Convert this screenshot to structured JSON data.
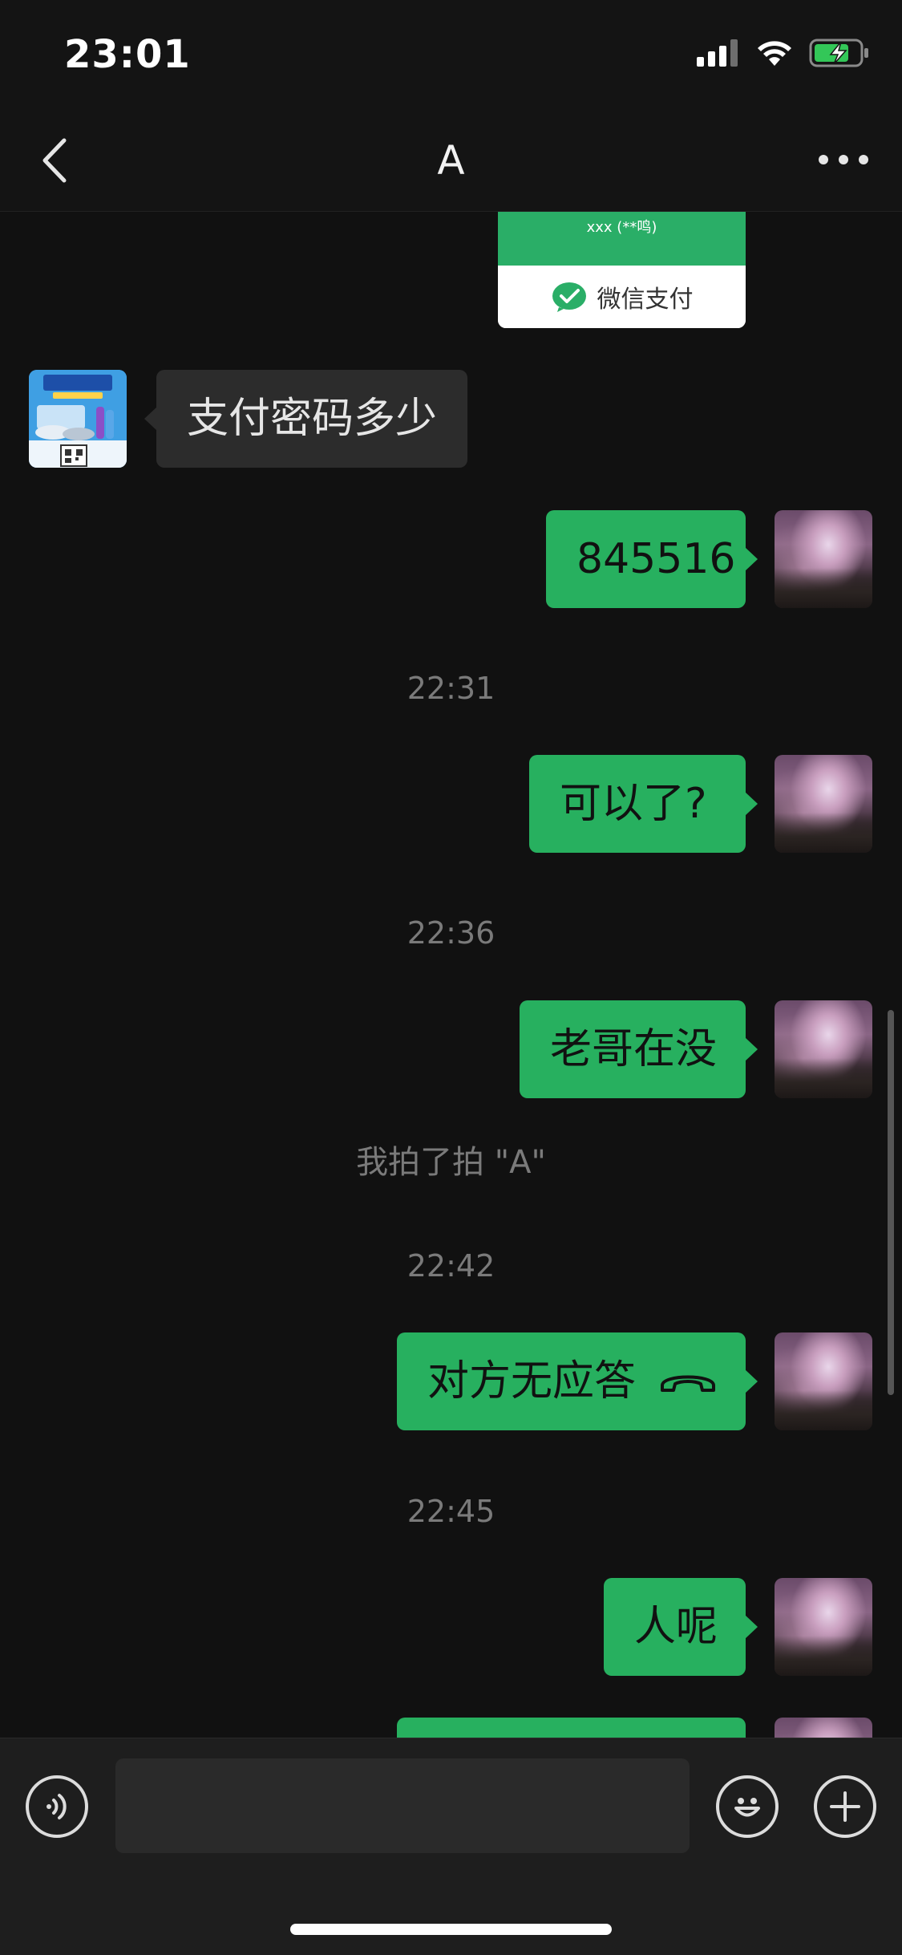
{
  "status_bar": {
    "time": "23:01"
  },
  "header": {
    "title": "A"
  },
  "payment_card": {
    "top_text": "xxx (**鸣)",
    "brand_label": "微信支付"
  },
  "messages": {
    "m1": "支付密码多少",
    "m2": "845516",
    "t1": "22:31",
    "m3": "可以了?",
    "t2": "22:36",
    "m4": "老哥在没",
    "sys1": "我拍了拍 \"A\"",
    "t3": "22:42",
    "m5": "对方无应答",
    "t4": "22:45",
    "m6": "人呢"
  },
  "input": {
    "placeholder": ""
  },
  "colors": {
    "accent_green": "#27b05f",
    "wechat_pay_green": "#2aae67",
    "background": "#111111",
    "left_bubble": "#2c2c2c"
  }
}
